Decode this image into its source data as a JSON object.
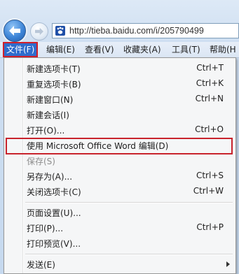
{
  "address_bar": {
    "url": "http://tieba.baidu.com/i/205790499"
  },
  "menubar": {
    "items": [
      {
        "label": "文件(F)",
        "active": true
      },
      {
        "label": "编辑(E)"
      },
      {
        "label": "查看(V)"
      },
      {
        "label": "收藏夹(A)"
      },
      {
        "label": "工具(T)"
      },
      {
        "label": "帮助(H"
      }
    ]
  },
  "file_menu": {
    "items": [
      {
        "label": "新建选项卡(T)",
        "shortcut": "Ctrl+T"
      },
      {
        "label": "重复选项卡(B)",
        "shortcut": "Ctrl+K"
      },
      {
        "label": "新建窗口(N)",
        "shortcut": "Ctrl+N"
      },
      {
        "label": "新建会话(I)",
        "shortcut": ""
      },
      {
        "label": "打开(O)...",
        "shortcut": "Ctrl+O"
      },
      {
        "label": "使用 Microsoft Office Word 编辑(D)",
        "shortcut": ""
      },
      {
        "label": "保存(S)",
        "shortcut": "",
        "disabled": true
      },
      {
        "label": "另存为(A)...",
        "shortcut": "Ctrl+S"
      },
      {
        "label": "关闭选项卡(C)",
        "shortcut": "Ctrl+W"
      },
      {
        "label": "页面设置(U)...",
        "shortcut": ""
      },
      {
        "label": "打印(P)...",
        "shortcut": "Ctrl+P"
      },
      {
        "label": "打印预览(V)...",
        "shortcut": ""
      },
      {
        "label": "发送(E)",
        "shortcut": ""
      }
    ]
  },
  "colors": {
    "active_menu": "#2f6ccd",
    "highlight_border": "#c8232c",
    "disabled_text": "#8d8d8d"
  },
  "icons": [
    "back-arrow-icon",
    "forward-arrow-icon",
    "paw-icon",
    "submenu-arrow-icon"
  ]
}
